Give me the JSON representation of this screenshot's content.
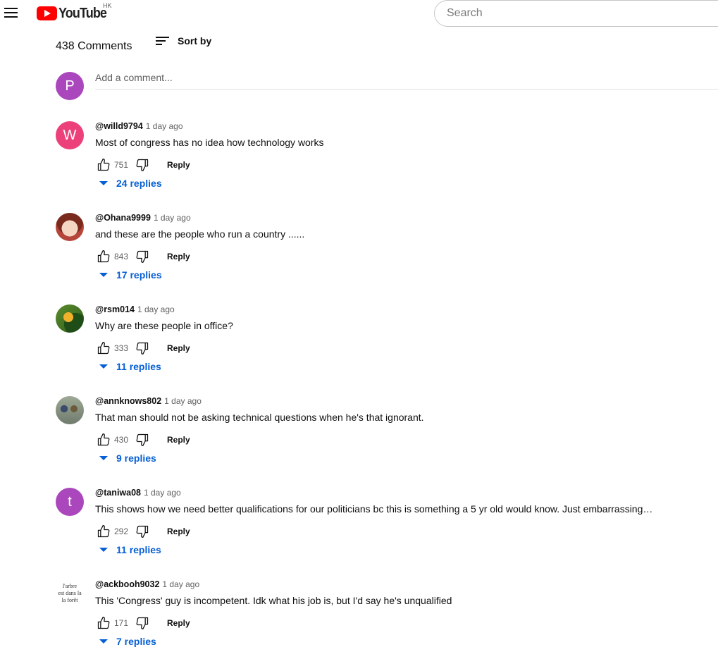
{
  "header": {
    "logo_text": "YouTube",
    "region": "HK",
    "search_placeholder": "Search"
  },
  "comments_section": {
    "count_label": "438 Comments",
    "sort_label": "Sort by",
    "add_comment_placeholder": "Add a comment...",
    "user_avatar_letter": "P",
    "reply_label": "Reply",
    "comments": [
      {
        "avatar_letter": "W",
        "avatar_color": "#ec407a",
        "author": "@willd9794",
        "time": "1 day ago",
        "text": "Most of congress has no idea how technology works",
        "likes": "751",
        "replies": "24 replies"
      },
      {
        "avatar_letter": "",
        "author": "@Ohana9999",
        "time": "1 day ago",
        "text": "and these are the people who run a country ......",
        "likes": "843",
        "replies": "17 replies"
      },
      {
        "avatar_letter": "",
        "author": "@rsm014",
        "time": "1 day ago",
        "text": "Why are these people in office?",
        "likes": "333",
        "replies": "11 replies"
      },
      {
        "avatar_letter": "",
        "author": "@annknows802",
        "time": "1 day ago",
        "text": "That man should not be asking technical questions when he's that ignorant.",
        "likes": "430",
        "replies": "9 replies"
      },
      {
        "avatar_letter": "t",
        "avatar_color": "#ab47bc",
        "author": "@taniwa08",
        "time": "1 day ago",
        "text": "This shows how we need better qualifications for our politicians bc this is something a 5 yr old would know. Just embarrassing…",
        "likes": "292",
        "replies": "11 replies"
      },
      {
        "avatar_text": [
          "l'arbre",
          "est dans la",
          "la forêt"
        ],
        "author": "@ackbooh9032",
        "time": "1 day ago",
        "text": "This 'Congress' guy is incompetent. Idk what his job is, but I'd say he's unqualified",
        "likes": "171",
        "replies": "7 replies"
      }
    ]
  },
  "colors": {
    "link_blue": "#065fd4",
    "brand_red": "#ff0000"
  }
}
